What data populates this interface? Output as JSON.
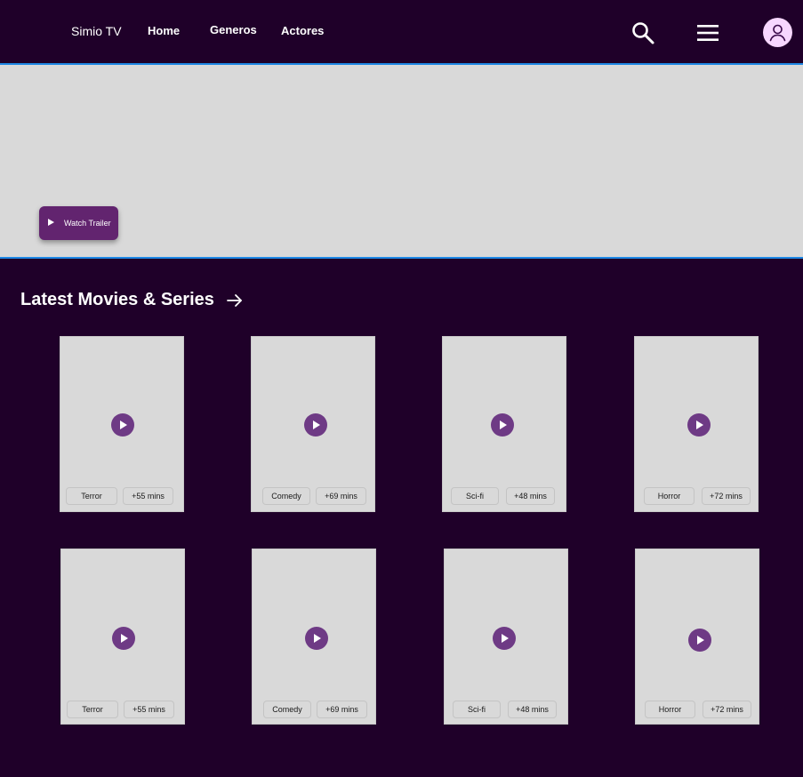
{
  "header": {
    "brand": "Simio TV",
    "nav": [
      "Home",
      "Generos",
      "Actores"
    ]
  },
  "hero": {
    "trailer_label": "Watch Trailer"
  },
  "section": {
    "title": "Latest Movies & Series"
  },
  "cards": [
    {
      "genre": "Terror",
      "duration": "+55 mins"
    },
    {
      "genre": "Comedy",
      "duration": "+69 mins"
    },
    {
      "genre": "Sci-fi",
      "duration": "+48 mins"
    },
    {
      "genre": "Horror",
      "duration": "+72 mins"
    },
    {
      "genre": "Terror",
      "duration": "+55 mins"
    },
    {
      "genre": "Comedy",
      "duration": "+69 mins"
    },
    {
      "genre": "Sci-fi",
      "duration": "+48 mins"
    },
    {
      "genre": "Horror",
      "duration": "+72 mins"
    }
  ],
  "colors": {
    "background": "#1f0029",
    "accent": "#62246f",
    "placeholder": "#d9d9d9",
    "divider": "#1e88e5",
    "avatar": "#f7d7ff"
  },
  "icons": {
    "search": "search-icon",
    "menu": "hamburger-menu-icon",
    "profile": "user-avatar-icon",
    "section_arrow": "arrow-right-icon",
    "play": "play-icon"
  }
}
